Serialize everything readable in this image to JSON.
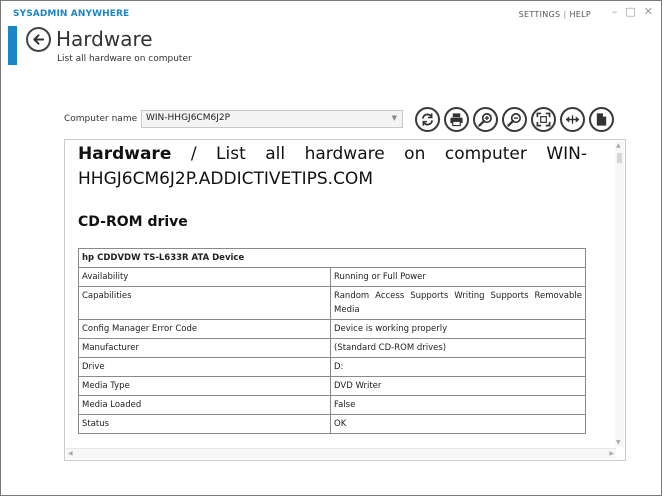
{
  "app": {
    "title": "SYSADMIN ANYWHERE",
    "links": {
      "settings": "SETTINGS",
      "separator": "|",
      "help": "HELP"
    },
    "window_controls": {
      "minimize": "–",
      "maximize": "□",
      "close": "✕"
    }
  },
  "header": {
    "title": "Hardware",
    "subtitle": "List all hardware on computer"
  },
  "computer": {
    "label": "Computer name",
    "selected": "WIN-HHGJ6CM6J2P"
  },
  "toolbar": {
    "buttons": [
      "refresh-icon",
      "print-icon",
      "zoom-in-icon",
      "zoom-out-icon",
      "fullscreen-icon",
      "fit-width-icon",
      "export-icon"
    ]
  },
  "report": {
    "title_bold": "Hardware",
    "title_rest": " / List all hardware on computer WIN-HHGJ6CM6J2P.ADDICTIVETIPS.COM",
    "section": "CD-ROM drive",
    "device": "hp CDDVDW TS-L633R ATA Device",
    "rows": [
      {
        "key": "Availability",
        "value": "Running or Full Power"
      },
      {
        "key": "Capabilities",
        "value": "Random Access Supports Writing Supports Removable Media"
      },
      {
        "key": "Config Manager Error Code",
        "value": "Device is working properly"
      },
      {
        "key": "Manufacturer",
        "value": "(Standard CD-ROM drives)"
      },
      {
        "key": "Drive",
        "value": "D:"
      },
      {
        "key": "Media Type",
        "value": "DVD Writer"
      },
      {
        "key": "Media Loaded",
        "value": "False"
      },
      {
        "key": "Status",
        "value": "OK"
      }
    ]
  },
  "colors": {
    "accent": "#1a86c8"
  }
}
